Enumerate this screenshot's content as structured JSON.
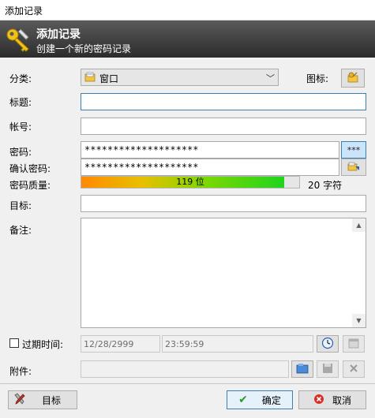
{
  "window": {
    "title": "添加记录"
  },
  "banner": {
    "title": "添加记录",
    "subtitle": "创建一个新的密码记录",
    "icon": "key-pencil-icon"
  },
  "form": {
    "group": {
      "label": "分类:",
      "value": "窗口",
      "icon": "folder-icon"
    },
    "icon_field": {
      "label": "图标:",
      "icon": "key-icon"
    },
    "title": {
      "label": "标题:",
      "value": ""
    },
    "username": {
      "label": "帐号:",
      "value": ""
    },
    "password": {
      "label": "密码:",
      "value": "********************",
      "toggle_label": "***"
    },
    "repeat": {
      "label": "确认密码:",
      "value": "********************",
      "generator_icon": "password-generator-icon"
    },
    "quality": {
      "label": "密码质量:",
      "bar_text": "119 位",
      "fill_percent": 93,
      "chars": "20 字符"
    },
    "url": {
      "label": "目标:",
      "value": ""
    },
    "notes": {
      "label": "备注:",
      "value": ""
    },
    "expires": {
      "label": "过期时间:",
      "date": "12/28/2999",
      "time": "23:59:59",
      "checked": false
    },
    "attachment": {
      "label": "附件:",
      "value": ""
    }
  },
  "footer": {
    "tools_label": "目标",
    "ok_label": "确定",
    "cancel_label": "取消"
  },
  "colors": {
    "banner_dark": "#2c2c2c",
    "focus": "#3c7fb1",
    "ok_border": "#3c7fb1"
  }
}
